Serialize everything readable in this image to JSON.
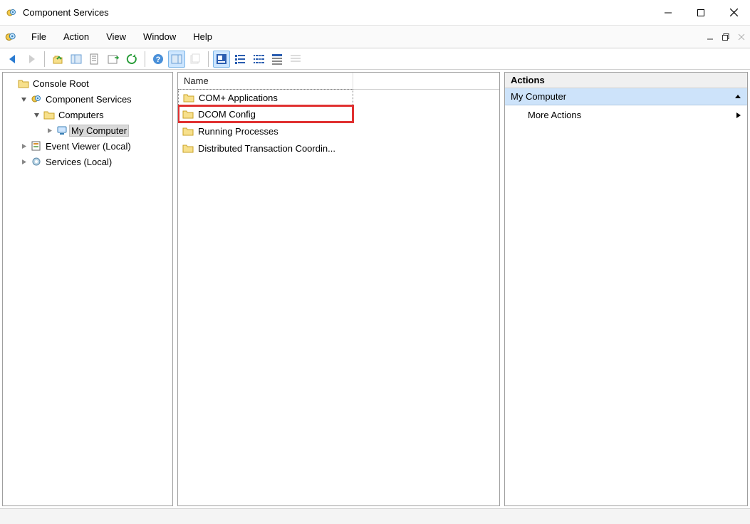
{
  "window": {
    "title": "Component Services"
  },
  "menu": {
    "items": [
      "File",
      "Action",
      "View",
      "Window",
      "Help"
    ]
  },
  "toolbar": {
    "buttons": [
      "back",
      "forward",
      "up",
      "show-hide-tree",
      "properties",
      "export-list",
      "refresh",
      "help",
      "show-hide-action",
      "new-window",
      "sep",
      "view-large",
      "view-small",
      "view-list",
      "view-detail",
      "view-custom"
    ]
  },
  "tree": {
    "root": "Console Root",
    "component_services": "Component Services",
    "computers": "Computers",
    "my_computer": "My Computer",
    "event_viewer": "Event Viewer (Local)",
    "services": "Services (Local)"
  },
  "list": {
    "header_name": "Name",
    "items": [
      {
        "label": "COM+ Applications",
        "selected": true,
        "highlight": false
      },
      {
        "label": "DCOM Config",
        "selected": false,
        "highlight": true
      },
      {
        "label": "Running Processes",
        "selected": false,
        "highlight": false
      },
      {
        "label": "Distributed Transaction Coordin...",
        "selected": false,
        "highlight": false
      }
    ]
  },
  "actions": {
    "header": "Actions",
    "subheader": "My Computer",
    "more": "More Actions"
  }
}
